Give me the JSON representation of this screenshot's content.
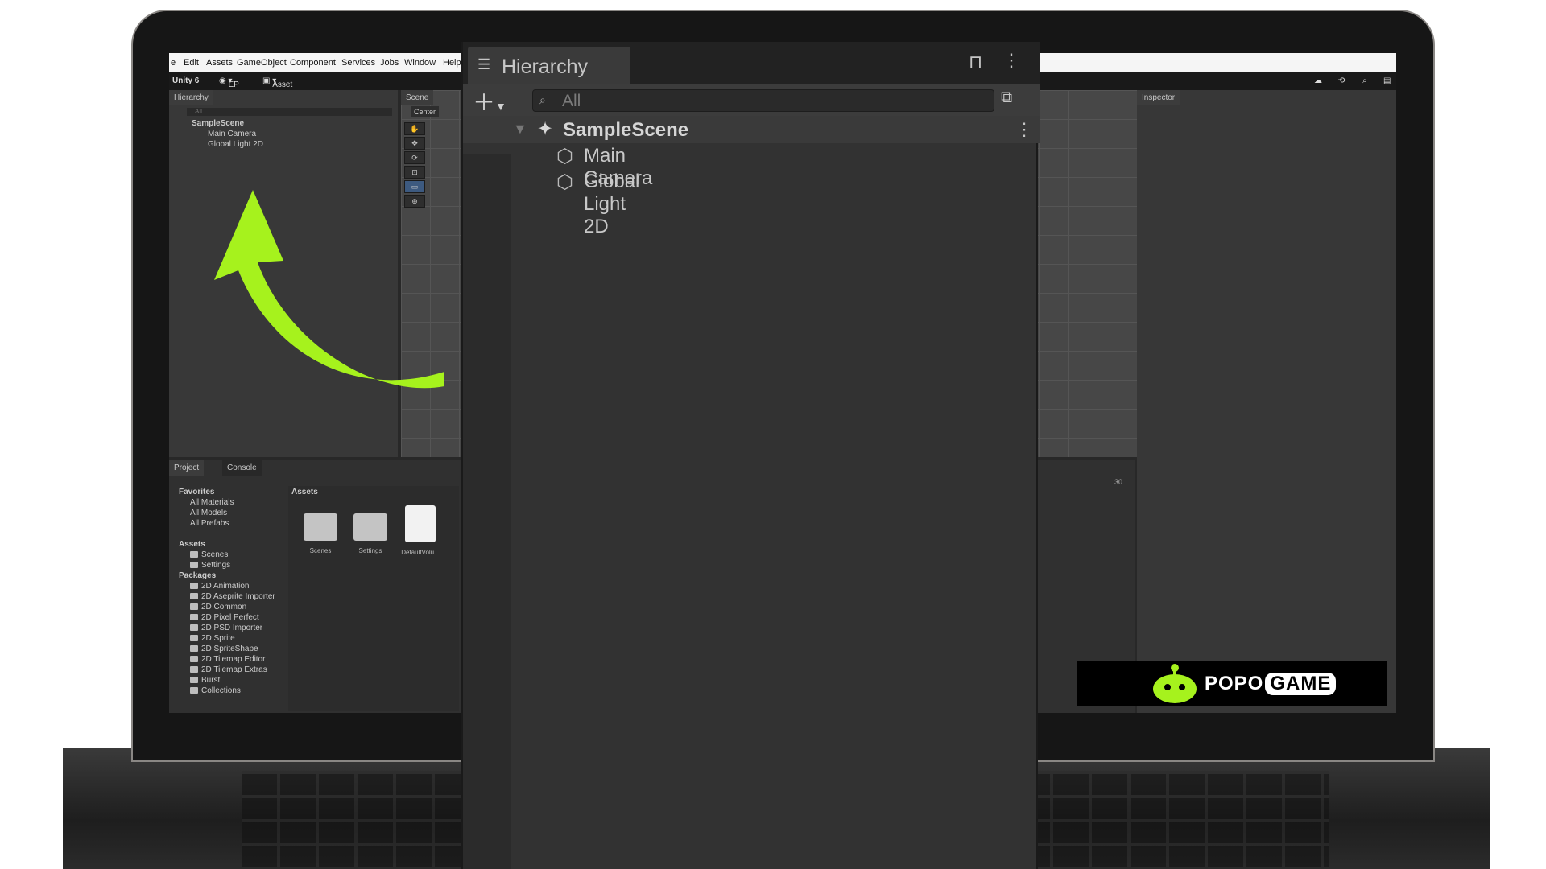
{
  "menu": [
    "e",
    "Edit",
    "Assets",
    "GameObject",
    "Component",
    "Services",
    "Jobs",
    "Window",
    "Help"
  ],
  "toolbar": {
    "project": "Unity 6",
    "account": "EP",
    "store": "Asset Store"
  },
  "hierarchy_small": {
    "title": "Hierarchy",
    "search": "All",
    "scene": "SampleScene",
    "items": [
      "Main Camera",
      "Global Light 2D"
    ]
  },
  "scene_tab": {
    "title": "Scene",
    "pivot": "Center"
  },
  "inspector": {
    "title": "Inspector"
  },
  "bottom_tabs": {
    "project": "Project",
    "console": "Console"
  },
  "favorites": {
    "label": "Favorites",
    "items": [
      "All Materials",
      "All Models",
      "All Prefabs"
    ]
  },
  "assets_tree": {
    "label": "Assets",
    "items": [
      "Scenes",
      "Settings"
    ]
  },
  "packages": {
    "label": "Packages",
    "items": [
      "2D Animation",
      "2D Aseprite Importer",
      "2D Common",
      "2D Pixel Perfect",
      "2D PSD Importer",
      "2D Sprite",
      "2D SpriteShape",
      "2D Tilemap Editor",
      "2D Tilemap Extras",
      "Burst",
      "Collections"
    ]
  },
  "assets_view": {
    "header": "Assets",
    "items": [
      "Scenes",
      "Settings",
      "DefaultVolu..."
    ]
  },
  "console_count": "30",
  "hierarchy_large": {
    "title": "Hierarchy",
    "search": "All",
    "scene": "SampleScene",
    "items": [
      "Main Camera",
      "Global Light 2D"
    ]
  },
  "logo": {
    "brand": "POPO",
    "suffix": "GAME"
  },
  "colors": {
    "arrow": "#a6f21d",
    "panel": "#323232",
    "logo_bg": "#000000"
  }
}
